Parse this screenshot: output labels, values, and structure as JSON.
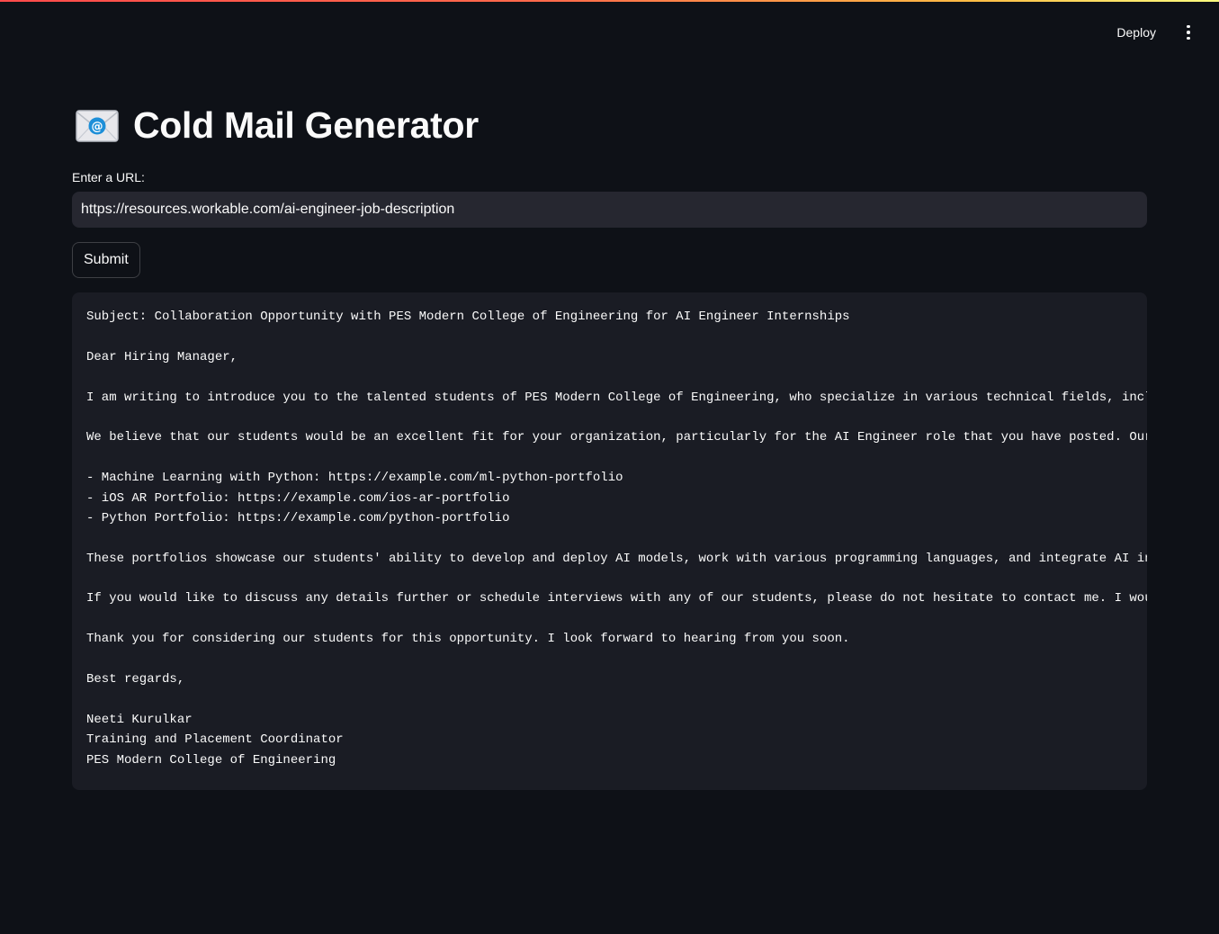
{
  "header": {
    "deploy_label": "Deploy",
    "menu_icon": "more-vertical-icon"
  },
  "main": {
    "title_icon": "email-icon",
    "title": "Cold Mail Generator",
    "url_field": {
      "label": "Enter a URL:",
      "value": "https://resources.workable.com/ai-engineer-job-description"
    },
    "submit_label": "Submit",
    "email_lines": [
      "Subject: Collaboration Opportunity with PES Modern College of Engineering for AI Engineer Internships",
      "",
      "Dear Hiring Manager,",
      "",
      "I am writing to introduce you to the talented students of PES Modern College of Engineering, who specialize in various technical fields, incl",
      "",
      "We believe that our students would be an excellent fit for your organization, particularly for the AI Engineer role that you have posted. Our",
      "",
      "- Machine Learning with Python: https://example.com/ml-python-portfolio",
      "- iOS AR Portfolio: https://example.com/ios-ar-portfolio",
      "- Python Portfolio: https://example.com/python-portfolio",
      "",
      "These portfolios showcase our students' ability to develop and deploy AI models, work with various programming languages, and integrate AI in",
      "",
      "If you would like to discuss any details further or schedule interviews with any of our students, please do not hesitate to contact me. I wou",
      "",
      "Thank you for considering our students for this opportunity. I look forward to hearing from you soon.",
      "",
      "Best regards,",
      "",
      "Neeti Kurulkar",
      "Training and Placement Coordinator",
      "PES Modern College of Engineering"
    ]
  },
  "colors": {
    "background": "#0e1117",
    "input_background": "#262730",
    "code_background": "#1a1c24",
    "text": "#fafafa",
    "accent_gradient_start": "#ff4b4b",
    "accent_gradient_end": "#fffd80"
  }
}
